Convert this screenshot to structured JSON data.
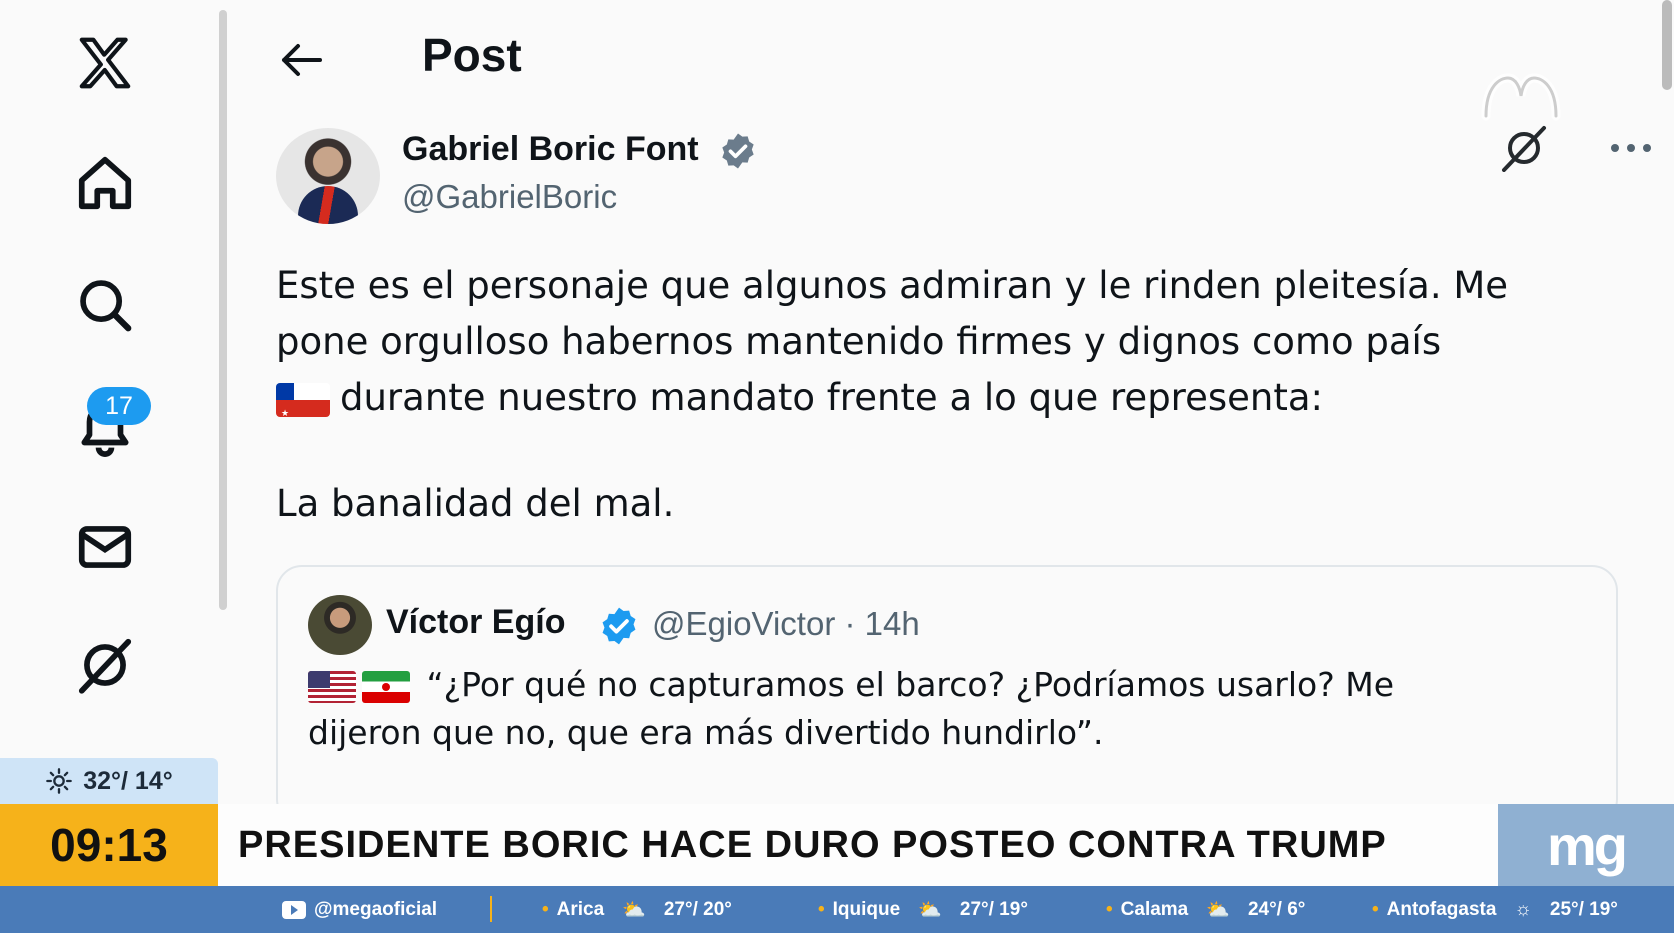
{
  "app": {
    "page_title": "Post"
  },
  "sidebar": {
    "items": [
      {
        "name": "x-logo"
      },
      {
        "name": "home"
      },
      {
        "name": "explore"
      },
      {
        "name": "notifications",
        "badge": "17"
      },
      {
        "name": "messages"
      },
      {
        "name": "grok"
      }
    ]
  },
  "post": {
    "author_name": "Gabriel Boric Font",
    "author_handle": "@GabrielBoric",
    "text_line1": "Este es el personaje que algunos admiran y le rinden pleitesía. Me",
    "text_line2": "pone orgulloso habernos mantenido firmes y dignos como país",
    "text_line3": "durante nuestro mandato frente a lo que representa:",
    "text_line4": "La banalidad del mal."
  },
  "quote": {
    "author_name": "Víctor Egío",
    "author_handle": "@EgioVictor · 14h",
    "text_line1": "“¿Por qué no capturamos el barco? ¿Podríamos usarlo? Me",
    "text_line2": "dijeron que no, que era más divertido hundirlo”."
  },
  "broadcast": {
    "weather": "32°/ 14°",
    "clock": "09:13",
    "headline": "PRESIDENTE BORIC HACE DURO POSTEO CONTRA TRUMP",
    "logo": "mg",
    "ticker": [
      {
        "label": "@megaoficial"
      },
      {
        "city": "Arica",
        "temp": "27°/ 20°"
      },
      {
        "city": "Iquique",
        "temp": "27°/ 19°"
      },
      {
        "city": "Calama",
        "temp": "24°/ 6°"
      },
      {
        "city": "Antofagasta",
        "temp": "25°/ 19°"
      }
    ]
  },
  "colors": {
    "accent": "#1d9bf0",
    "clock_bg": "#f6b21a",
    "ticker_bg": "#4a7bb8"
  }
}
